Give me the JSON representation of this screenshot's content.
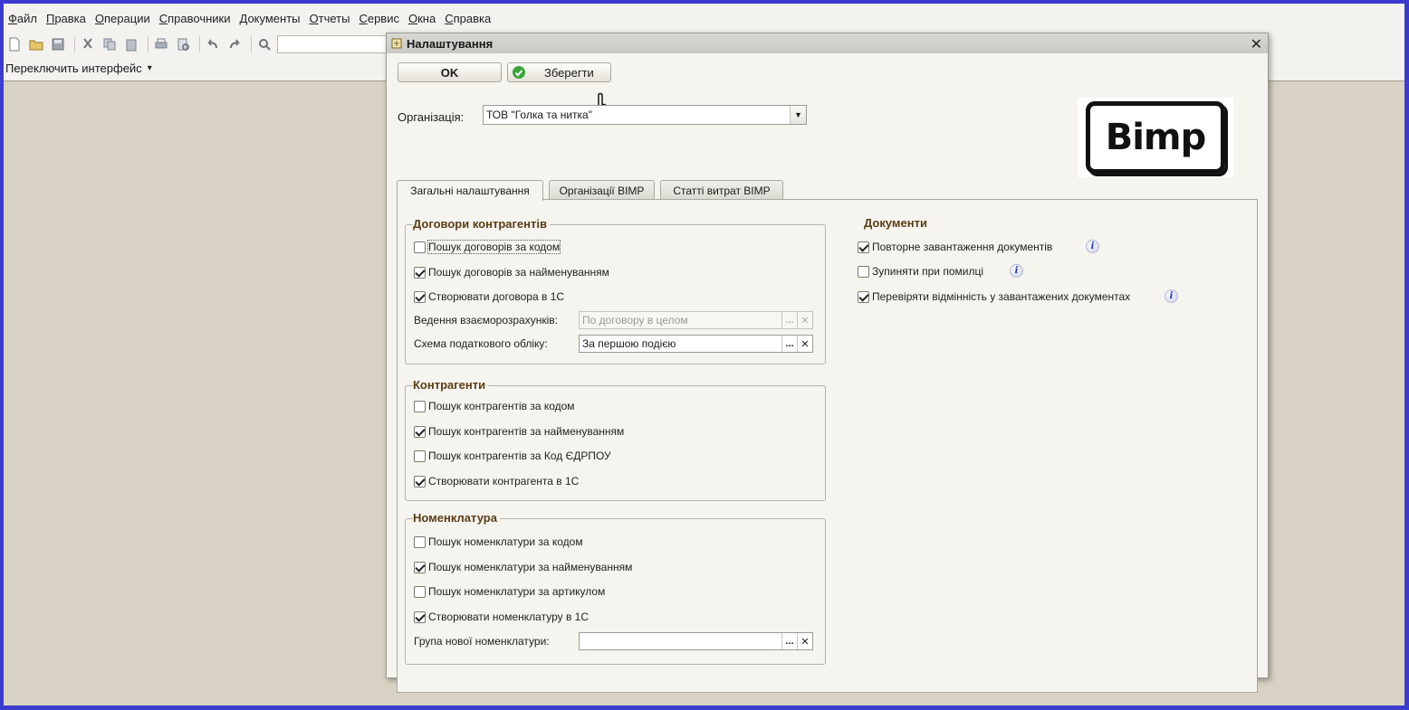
{
  "menu": [
    "Файл",
    "Правка",
    "Операции",
    "Справочники",
    "Документы",
    "Отчеты",
    "Сервис",
    "Окна",
    "Справка"
  ],
  "switch_interface": "Переключить интерфейс",
  "dialog": {
    "title": "Налаштування",
    "ok_label": "OK",
    "save_label": "Зберегти",
    "org_label": "Організація:",
    "org_value": "ТОВ \"Голка та нитка\"",
    "logo_text": "Bimp",
    "tabs": [
      "Загальні налаштування",
      "Організації ВІМР",
      "Статті витрат ВІМР"
    ],
    "active_tab": 0
  },
  "contracts": {
    "title": "Договори контрагентів",
    "items": [
      {
        "label": "Пошук договорів за кодом",
        "checked": false
      },
      {
        "label": "Пошук договорів за найменуванням",
        "checked": true
      },
      {
        "label": "Створювати договора  в 1С",
        "checked": true
      }
    ],
    "settlement_label": "Ведення взаєморозрахунків:",
    "settlement_value": "По договору в целом",
    "tax_label": "Схема податкового обліку:",
    "tax_value": "За першою подією"
  },
  "counterparties": {
    "title": "Контрагенти",
    "items": [
      {
        "label": "Пошук контрагентів за кодом",
        "checked": false
      },
      {
        "label": "Пошук контрагентів за найменуванням",
        "checked": true
      },
      {
        "label": "Пошук контрагентів за Код ЄДРПОУ",
        "checked": false
      },
      {
        "label": "Створювати контрагента  в 1С",
        "checked": true
      }
    ]
  },
  "nomenclature": {
    "title": "Номенклатура",
    "items": [
      {
        "label": "Пошук номенклатури за кодом",
        "checked": false
      },
      {
        "label": "Пошук номенклатури за найменуванням",
        "checked": true
      },
      {
        "label": "Пошук номенклатури за артикулом",
        "checked": false
      },
      {
        "label": "Створювати номенклатуру  в 1С",
        "checked": true
      }
    ],
    "group_label": "Група нової номенклатури:",
    "group_value": ""
  },
  "documents": {
    "title": "Документи",
    "items": [
      {
        "label": "Повторне завантаження документів",
        "checked": true
      },
      {
        "label": "Зупиняти при помилці",
        "checked": false
      },
      {
        "label": "Перевіряти відмінність у завантажених документах",
        "checked": true
      }
    ]
  },
  "colors": {
    "outer_frame": "#3b3ccf",
    "desktop": "#d7d2c3",
    "group_title": "#5c3c14",
    "save_check": "#3aa53a",
    "info_icon": "#1d2fb8"
  }
}
